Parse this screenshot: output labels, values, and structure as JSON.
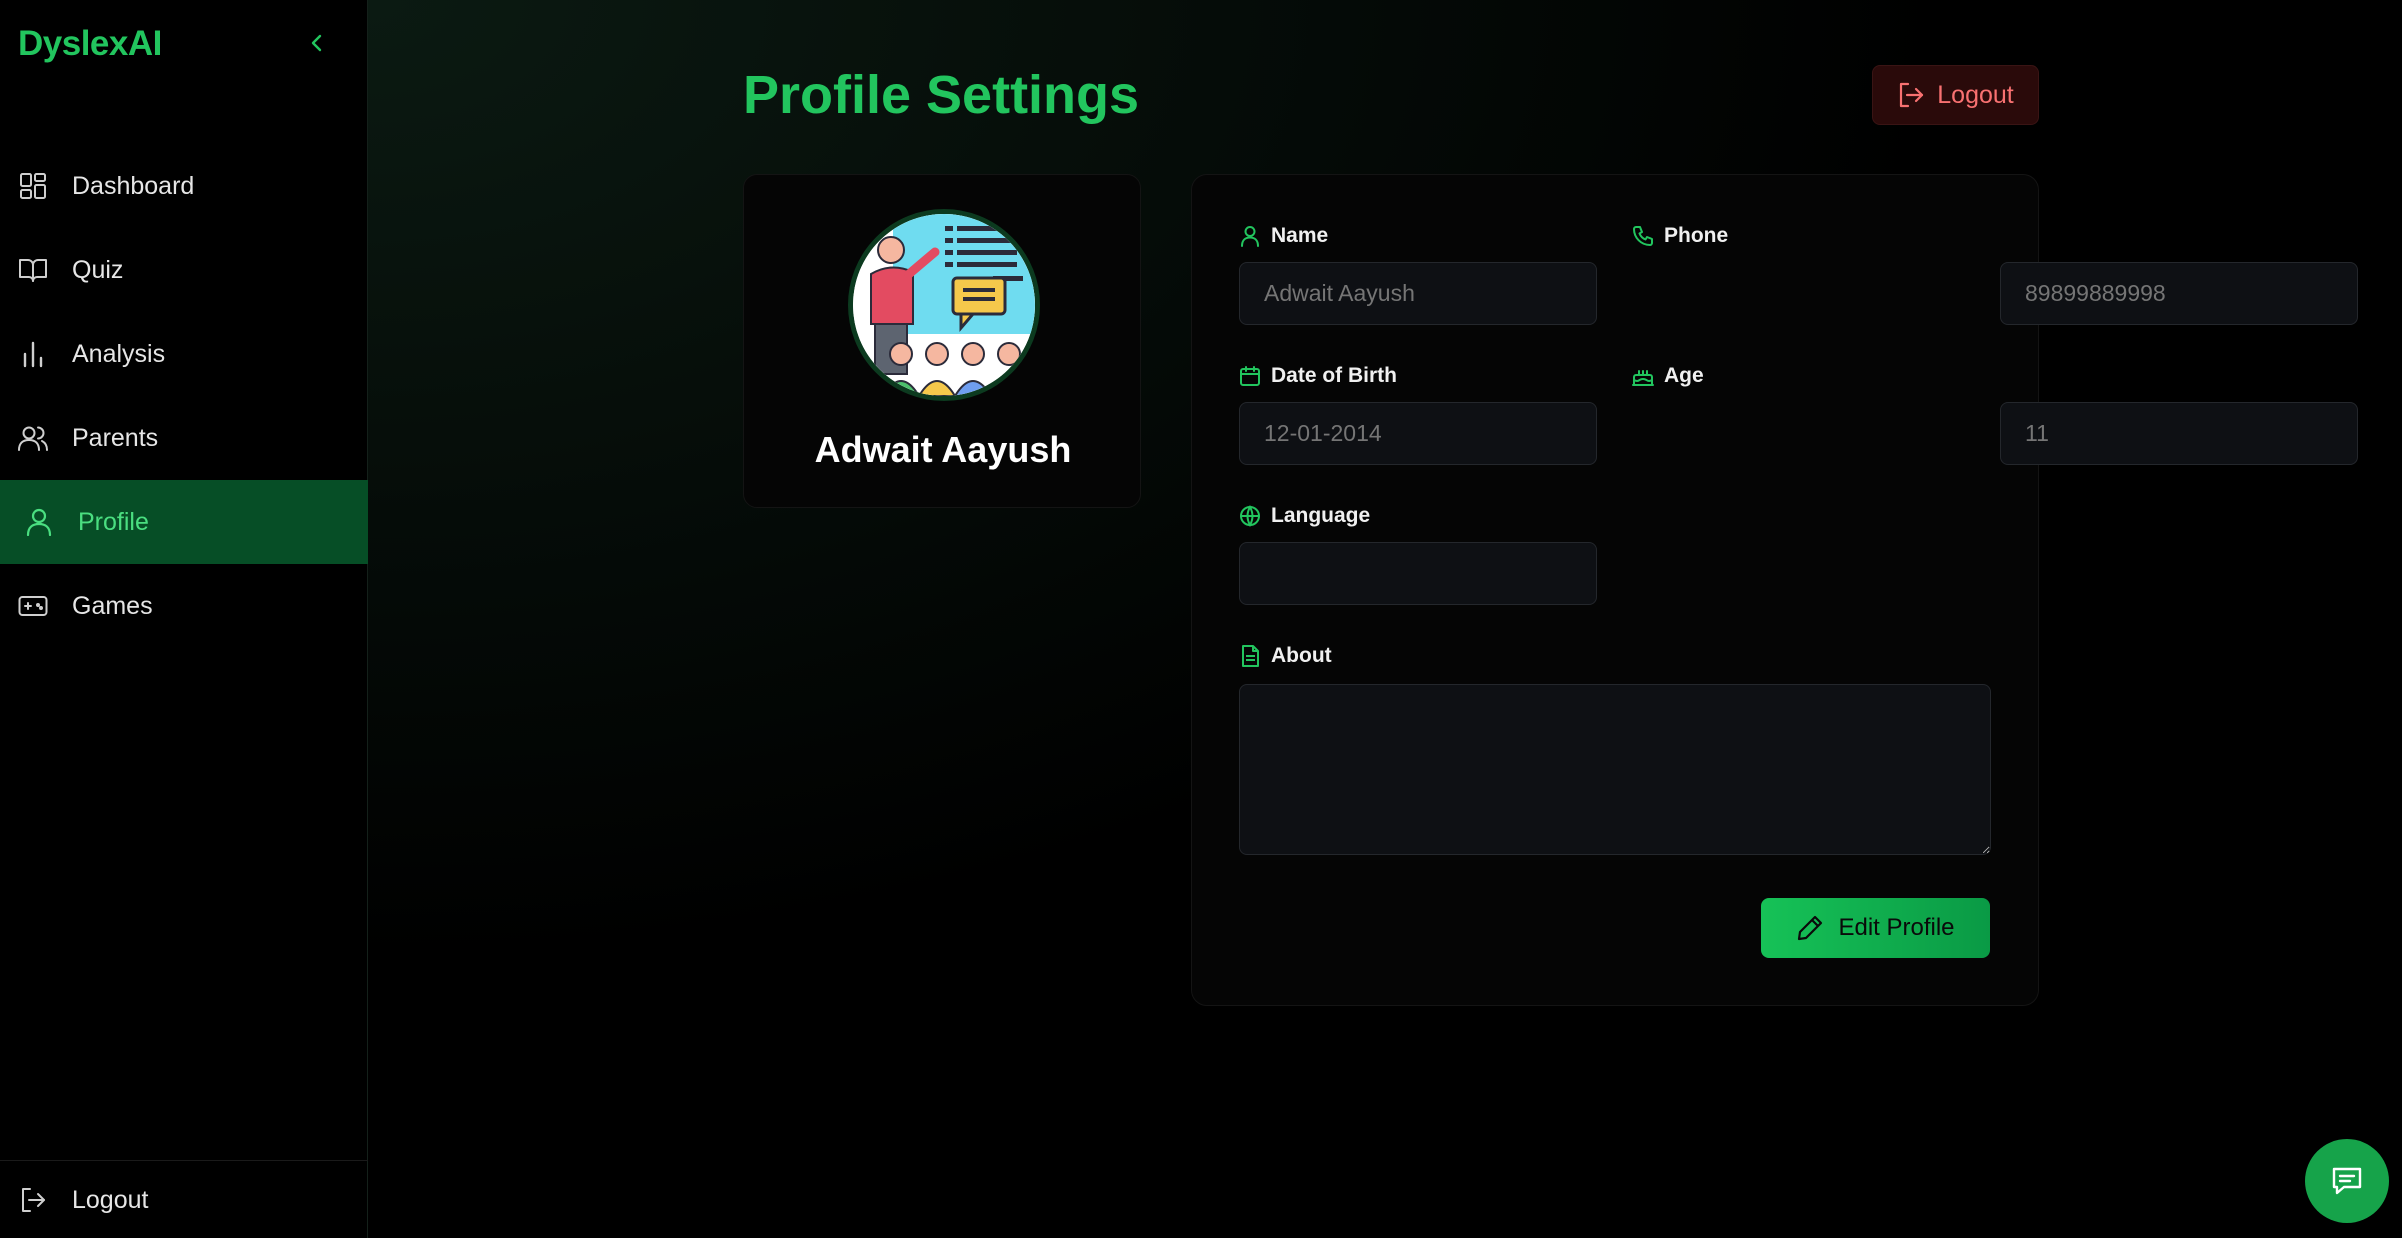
{
  "app": {
    "brand": "DyslexAI",
    "accent": "#22c55e",
    "danger": "#f87171"
  },
  "sidebar": {
    "items": [
      {
        "label": "Dashboard",
        "icon": "dashboard-icon"
      },
      {
        "label": "Quiz",
        "icon": "book-icon"
      },
      {
        "label": "Analysis",
        "icon": "bar-chart-icon"
      },
      {
        "label": "Parents",
        "icon": "users-icon"
      },
      {
        "label": "Profile",
        "icon": "user-icon",
        "active": true
      },
      {
        "label": "Games",
        "icon": "gamepad-icon"
      }
    ],
    "footer_logout": "Logout"
  },
  "header": {
    "title": "Profile Settings",
    "logout_label": "Logout"
  },
  "profile": {
    "name": "Adwait Aayush"
  },
  "form": {
    "name_label": "Name",
    "name_placeholder": "Adwait Aayush",
    "phone_label": "Phone",
    "phone_placeholder": "89899889998",
    "dob_label": "Date of Birth",
    "dob_placeholder": "12-01-2014",
    "age_label": "Age",
    "age_placeholder": "11",
    "language_label": "Language",
    "language_placeholder": "",
    "about_label": "About",
    "about_placeholder": "",
    "edit_label": "Edit Profile"
  }
}
